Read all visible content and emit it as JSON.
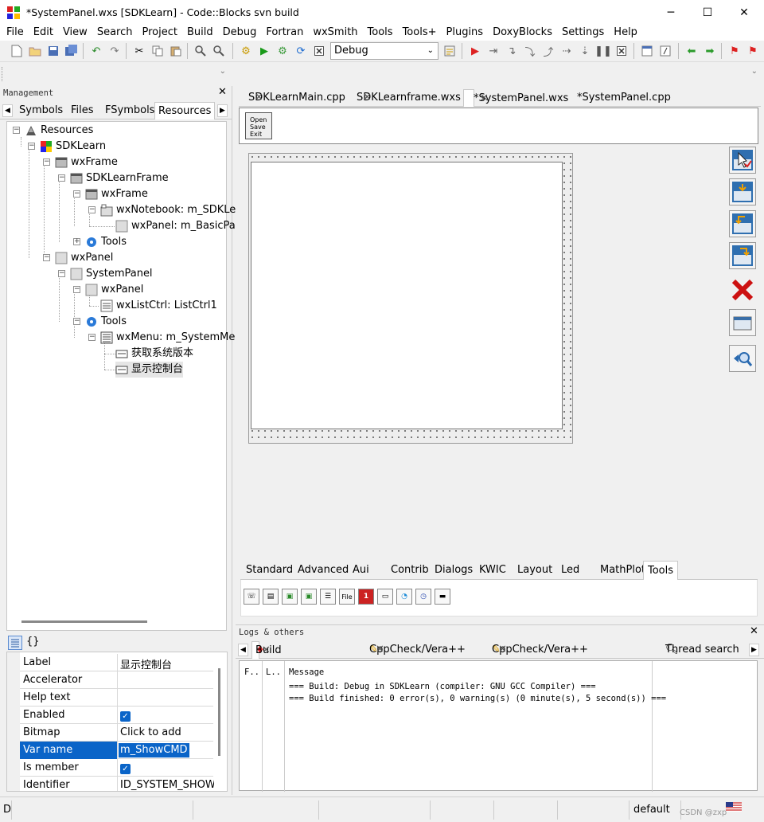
{
  "window": {
    "title": "*SystemPanel.wxs [SDKLearn] - Code::Blocks svn build",
    "minimize_glyph": "─",
    "maximize_glyph": "☐",
    "close_glyph": "✕"
  },
  "menu": [
    "File",
    "Edit",
    "View",
    "Search",
    "Project",
    "Build",
    "Debug",
    "Fortran",
    "wxSmith",
    "Tools",
    "Tools+",
    "Plugins",
    "DoxyBlocks",
    "Settings",
    "Help"
  ],
  "toolbar": {
    "build_target": "Debug"
  },
  "management": {
    "header": "Management",
    "tabs": [
      "Symbols",
      "Files",
      "FSymbols",
      "Resources"
    ],
    "tree": [
      {
        "label": "Resources",
        "icon": "resources-icon"
      },
      {
        "label": "SDKLearn",
        "icon": "project-icon"
      },
      {
        "label": "wxFrame",
        "icon": "frame-icon"
      },
      {
        "label": "SDKLearnFrame",
        "icon": "frame-icon"
      },
      {
        "label": "wxFrame",
        "icon": "frame-icon"
      },
      {
        "label": "wxNotebook: m_SDKLe",
        "icon": "notebook-icon"
      },
      {
        "label": "wxPanel: m_BasicPag",
        "icon": "panel-icon"
      },
      {
        "label": "Tools",
        "icon": "tools-icon"
      },
      {
        "label": "wxPanel",
        "icon": "panel-icon"
      },
      {
        "label": "SystemPanel",
        "icon": "panel-icon"
      },
      {
        "label": "wxPanel",
        "icon": "panel-icon"
      },
      {
        "label": "wxListCtrl: ListCtrl1",
        "icon": "listctrl-icon"
      },
      {
        "label": "Tools",
        "icon": "tools-icon"
      },
      {
        "label": "wxMenu: m_SystemMer",
        "icon": "menu-icon"
      },
      {
        "label": "获取系统版本",
        "icon": "menuitem-icon"
      },
      {
        "label": "显示控制台",
        "icon": "menuitem-icon"
      }
    ]
  },
  "properties": {
    "tab_glyph": "{}",
    "rows": [
      {
        "key": "Label",
        "value": "显示控制台"
      },
      {
        "key": "Accelerator",
        "value": ""
      },
      {
        "key": "Help text",
        "value": ""
      },
      {
        "key": "Enabled",
        "value": "✓"
      },
      {
        "key": "Bitmap",
        "value": "Click to add"
      },
      {
        "key": "Var name",
        "value": "m_ShowCMD"
      },
      {
        "key": "Is member",
        "value": "✓"
      },
      {
        "key": "Identifier",
        "value": "ID_SYSTEM_SHOWC"
      }
    ]
  },
  "editor": {
    "tabs": [
      "SDKLearnMain.cpp",
      "SDKLearnframe.wxs",
      "*SystemPanel.wxs",
      "*SystemPanel.cpp"
    ],
    "open_button": [
      "Open",
      "Save",
      "Exit"
    ]
  },
  "palette": {
    "tabs": [
      "Standard",
      "Advanced",
      "Aui",
      "Contrib",
      "Dialogs",
      "KWIC",
      "Layout",
      "Led",
      "MathPlot",
      "Tools"
    ],
    "active": "Tools"
  },
  "logs": {
    "header": "Logs & others",
    "tabs": [
      "Build messages",
      "CppCheck/Vera++",
      "CppCheck/Vera++ messages",
      "Thread search"
    ],
    "columns": [
      "F..",
      "L..",
      "Message"
    ],
    "lines": [
      "=== Build: Debug in SDKLearn (compiler: GNU GCC Compiler) ===",
      "=== Build finished: 0 error(s), 0 warning(s) (0 minute(s), 5 second(s)) ==="
    ]
  },
  "status": {
    "left": "D",
    "mode": "default",
    "watermark": "CSDN @zxp"
  }
}
